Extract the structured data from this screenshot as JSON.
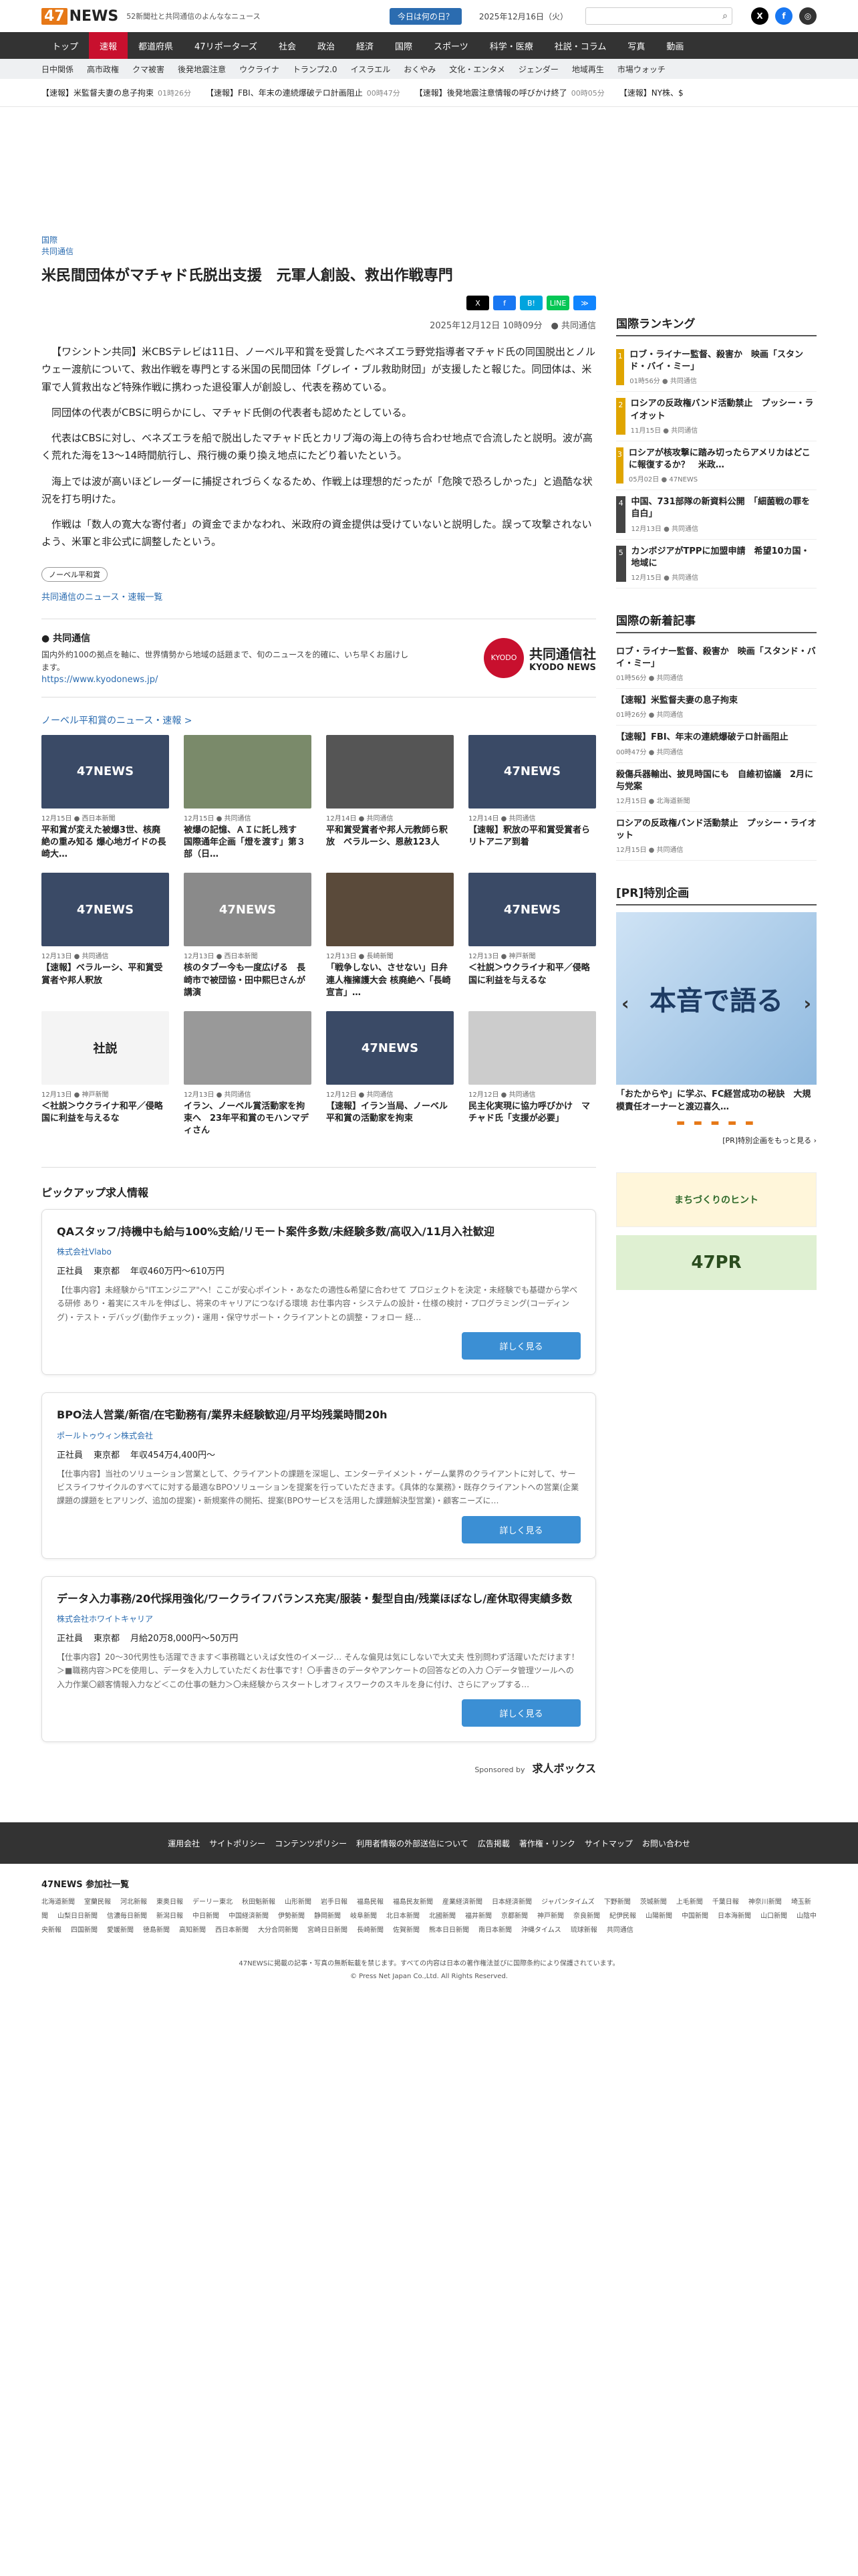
{
  "header": {
    "logo": "NEWS",
    "logo_num": "47",
    "tagline": "52新聞社と共同通信のよんななニュース",
    "today_button": "今日は何の日？",
    "date": "2025年12月16日（火）"
  },
  "nav": [
    "トップ",
    "速報",
    "都道府県",
    "47リポーターズ",
    "社会",
    "政治",
    "経済",
    "国際",
    "スポーツ",
    "科学・医療",
    "社説・コラム",
    "写真",
    "動画"
  ],
  "subnav": [
    "日中関係",
    "高市政権",
    "クマ被害",
    "後発地震注意",
    "ウクライナ",
    "トランプ2.0",
    "イスラエル",
    "おくやみ",
    "文化・エンタメ",
    "ジェンダー",
    "地域再生",
    "市場ウォッチ"
  ],
  "breaking": [
    {
      "text": "【速報】米監督夫妻の息子拘束",
      "time": "01時26分"
    },
    {
      "text": "【速報】FBI、年末の連続爆破テロ計画阻止",
      "time": "00時47分"
    },
    {
      "text": "【速報】後発地震注意情報の呼びかけ終了",
      "time": "00時05分"
    },
    {
      "text": "【速報】NY株、$",
      "time": ""
    }
  ],
  "article": {
    "category": "国際",
    "source": "共同通信",
    "title": "米民間団体がマチャド氏脱出支援　元軍人創設、救出作戦専門",
    "share": [
      "X",
      "f",
      "B!",
      "LINE",
      "≫"
    ],
    "byline": "2025年12月12日 10時09分",
    "byline_src": "共同通信",
    "paragraphs": [
      "【ワシントン共同】米CBSテレビは11日、ノーベル平和賞を受賞したベネズエラ野党指導者マチャド氏の同国脱出とノルウェー渡航について、救出作戦を専門とする米国の民間団体「グレイ・ブル救助財団」が支援したと報じた。同団体は、米軍で人質救出など特殊作戦に携わった退役軍人が創設し、代表を務めている。",
      "同団体の代表がCBSに明らかにし、マチャド氏側の代表者も認めたとしている。",
      "代表はCBSに対し、ベネズエラを船で脱出したマチャド氏とカリブ海の海上の待ち合わせ地点で合流したと説明。波が高く荒れた海を13〜14時間航行し、飛行機の乗り換え地点にたどり着いたという。",
      "海上では波が高いほどレーダーに捕捉されづらくなるため、作戦上は理想的だったが「危険で恐ろしかった」と過酷な状況を打ち明けた。",
      "作戦は「数人の寛大な寄付者」の資金でまかなわれ、米政府の資金提供は受けていないと説明した。誤って攻撃されないよう、米軍と非公式に調整したという。"
    ],
    "tag": "ノーベル平和賞",
    "more_link": "共同通信のニュース・速報一覧"
  },
  "kyodo": {
    "name": "共同通信",
    "desc": "国内外約100の拠点を軸に、世界情勢から地域の話題まで、旬のニュースを的確に、いち早くお届けします。",
    "url": "https://www.kyodonews.jp/",
    "logo_text": "共同通信社",
    "logo_sub": "KYODO NEWS"
  },
  "nobel": {
    "title": "ノーベル平和賞のニュース・速報 >",
    "cards": [
      {
        "date": "12月15日",
        "src": "西日本新聞",
        "title": "平和賞が変えた被爆3世、核廃絶の重み知る 爆心地ガイドの長崎大…",
        "thumb": "47NEWS"
      },
      {
        "date": "12月15日",
        "src": "共同通信",
        "title": "被爆の記憶、ＡＩに託し残す　国際通年企画「燈を渡す」第３部（日…",
        "thumb": ""
      },
      {
        "date": "12月14日",
        "src": "共同通信",
        "title": "平和賞受賞者や邦人元教師ら釈放　ベラルーシ、恩赦123人",
        "thumb": ""
      },
      {
        "date": "12月14日",
        "src": "共同通信",
        "title": "【速報】釈放の平和賞受賞者らリトアニア到着",
        "thumb": "47NEWS"
      },
      {
        "date": "12月13日",
        "src": "共同通信",
        "title": "【速報】ベラルーシ、平和賞受賞者や邦人釈放",
        "thumb": "47NEWS"
      },
      {
        "date": "12月13日",
        "src": "西日本新聞",
        "title": "核のタブー今も一度広げる　長崎市で被団協・田中熙巳さんが講演",
        "thumb": "47NEWS"
      },
      {
        "date": "12月13日",
        "src": "長崎新聞",
        "title": "「戦争しない、させない」日弁連人権擁護大会 核廃絶へ「長崎宣言」…",
        "thumb": ""
      },
      {
        "date": "12月13日",
        "src": "神戸新聞",
        "title": "＜社説＞ウクライナ和平／侵略国に利益を与えるな",
        "thumb": "47NEWS"
      },
      {
        "date": "12月13日",
        "src": "神戸新聞",
        "title": "＜社説＞ウクライナ和平／侵略国に利益を与えるな",
        "thumb": "社説"
      },
      {
        "date": "12月13日",
        "src": "共同通信",
        "title": "イラン、ノーベル賞活動家を拘束へ　23年平和賞のモハンマディさん",
        "thumb": ""
      },
      {
        "date": "12月12日",
        "src": "共同通信",
        "title": "【速報】イラン当局、ノーベル平和賞の活動家を拘束",
        "thumb": "47NEWS"
      },
      {
        "date": "12月12日",
        "src": "共同通信",
        "title": "民主化実現に協力呼びかけ　マチャド氏「支援が必要」",
        "thumb": ""
      }
    ]
  },
  "jobs": {
    "title": "ピックアップ求人情報",
    "items": [
      {
        "title": "QAスタッフ/持機中も給与100%支給/リモート案件多数/未経験多数/高収入/11月入社歓迎",
        "company": "株式会社Vlabo",
        "type": "正社員",
        "place": "東京都",
        "salary": "年収460万円〜610万円",
        "text": "【仕事内容】未経験から\"ITエンジニア\"へ！ここが安心ポイント・あなたの適性&希望に合わせて プロジェクトを決定・未経験でも基礎から学べる研修 あり・着実にスキルを伸ばし、将来のキャリアにつなげる環境 お仕事内容・システムの設計・仕様の検討・プログラミング(コーディング)・テスト・デバッグ(動作チェック)・運用・保守サポート・クライアントとの調整・フォロー 経…",
        "button": "詳しく見る"
      },
      {
        "title": "BPO法人営業/新宿/在宅勤務有/業界未経験歓迎/月平均残業時間20h",
        "company": "ポールトゥウィン株式会社",
        "type": "正社員",
        "place": "東京都",
        "salary": "年収454万4,400円〜",
        "text": "【仕事内容】当社のソリューション営業として、クライアントの課題を深堀し、エンターテイメント・ゲーム業界のクライアントに対して、サービスライフサイクルのすべてに対する最適なBPOソリューションを提案を行っていただきます。《具体的な業務》・既存クライアントへの営業(企業課題の課題をヒアリング、追加の提案)・新規案件の開拓、提案(BPOサービスを活用した課題解決型営業)・顧客ニーズに…",
        "button": "詳しく見る"
      },
      {
        "title": "データ入力事務/20代採用強化/ワークライフバランス充実/服装・髪型自由/残業ほぼなし/産休取得実績多数",
        "company": "株式会社ホワイトキャリア",
        "type": "正社員",
        "place": "東京都",
        "salary": "月給20万8,000円〜50万円",
        "text": "【仕事内容】20〜30代男性も活躍できます＜事務職といえば女性のイメージ… そんな偏見は気にしないで大丈夫 性別問わず活躍いただけます！＞■職務内容＞PCを使用し、データを入力していただくお仕事です！〇手書きのデータやアンケートの回答などの入力 〇データ管理ツールへの入力作業〇顧客情報入力など＜この仕事の魅力＞〇未経験からスタートしオフィスワークのスキルを身に付け、さらにアップする…",
        "button": "詳しく見る"
      }
    ],
    "sponsor_label": "Sponsored by",
    "sponsor_name": "求人ボックス"
  },
  "sidebar": {
    "ranking_title": "国際ランキング",
    "ranking": [
      {
        "title": "ロブ・ライナー監督、殺害か　映画「スタンド・バイ・ミー」",
        "meta": "01時56分",
        "src": "共同通信"
      },
      {
        "title": "ロシアの反政権バンド活動禁止　プッシー・ライオット",
        "meta": "11月15日",
        "src": "共同通信"
      },
      {
        "title": "ロシアが核攻撃に踏み切ったらアメリカはどこに報復するか？　米政…",
        "meta": "05月02日",
        "src": "47NEWS"
      },
      {
        "title": "中国、731部隊の新資料公開　「細菌戦の罪を自白」",
        "meta": "12月13日",
        "src": "共同通信"
      },
      {
        "title": "カンボジアがTPPに加盟申請　希望10カ国・地域に",
        "meta": "12月15日",
        "src": "共同通信"
      }
    ],
    "newest_title": "国際の新着記事",
    "newest": [
      {
        "title": "ロブ・ライナー監督、殺害か　映画「スタンド・バイ・ミー」",
        "meta": "01時56分",
        "src": "共同通信"
      },
      {
        "title": "【速報】米監督夫妻の息子拘束",
        "meta": "01時26分",
        "src": "共同通信"
      },
      {
        "title": "【速報】FBI、年末の連続爆破テロ計画阻止",
        "meta": "00時47分",
        "src": "共同通信"
      },
      {
        "title": "殺傷兵器輸出、披見時国にも　自維初協議　2月に与党案",
        "meta": "12月15日",
        "src": "北海道新聞"
      },
      {
        "title": "ロシアの反政権バンド活動禁止　プッシー・ライオット",
        "meta": "12月15日",
        "src": "共同通信"
      }
    ],
    "pr_title": "[PR]特別企画",
    "pr_banner": "本音で語る",
    "pr_caption": "「おたからや」に学ぶ、FC経営成功の秘訣　大規模責任オーナーと渡辺喜久…",
    "pr_more": "[PR]特別企画をもっと見る ›",
    "ad1": "まちづくりのヒント",
    "ad2": "47PR"
  },
  "footer": {
    "links": [
      "運用会社",
      "サイトポリシー",
      "コンテンツポリシー",
      "利用者情報の外部送信について",
      "広告掲載",
      "著作権・リンク",
      "サイトマップ",
      "お問い合わせ"
    ],
    "members_title": "47NEWS 参加社一覧",
    "members": [
      "北海道新聞",
      "室蘭民報",
      "河北新報",
      "東奥日報",
      "デーリー東北",
      "秋田魁新報",
      "山形新聞",
      "岩手日報",
      "福島民報",
      "福島民友新聞",
      "産業経済新聞",
      "日本経済新聞",
      "ジャパンタイムズ",
      "下野新聞",
      "茨城新聞",
      "上毛新聞",
      "千葉日報",
      "神奈川新聞",
      "埼玉新聞",
      "山梨日日新聞",
      "信濃毎日新聞",
      "新潟日報",
      "中日新聞",
      "中国経済新聞",
      "伊勢新聞",
      "静岡新聞",
      "岐阜新聞",
      "北日本新聞",
      "北國新聞",
      "福井新聞",
      "京都新聞",
      "神戸新聞",
      "奈良新聞",
      "紀伊民報",
      "山陽新聞",
      "中国新聞",
      "日本海新聞",
      "山口新聞",
      "山陰中央新報",
      "四国新聞",
      "愛媛新聞",
      "徳島新聞",
      "高知新聞",
      "西日本新聞",
      "大分合同新聞",
      "宮崎日日新聞",
      "長崎新聞",
      "佐賀新聞",
      "熊本日日新聞",
      "南日本新聞",
      "沖縄タイムス",
      "琉球新報",
      "共同通信"
    ],
    "notice": "47NEWSに掲載の記事・写真の無断転載を禁じます。すべての内容は日本の著作権法並びに国際条約により保護されています。",
    "copyright": "© Press Net Japan Co.,Ltd. All Rights Reserved."
  }
}
